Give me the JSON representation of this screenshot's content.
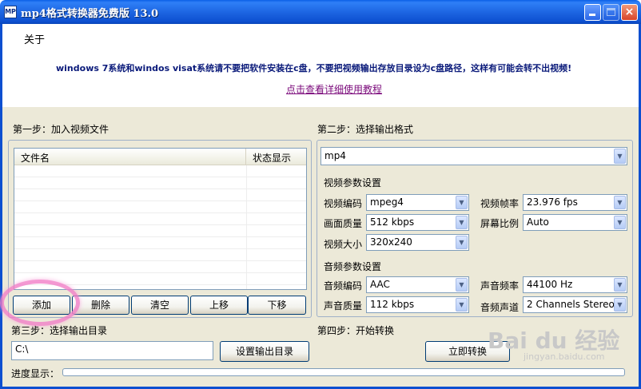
{
  "window": {
    "title": "mp4格式转换器免费版 13.0",
    "icon_label": "MP",
    "controls": {
      "minimize": "minimize-icon",
      "maximize": "maximize-icon",
      "close": "×"
    }
  },
  "header": {
    "about_label": "关于",
    "warning_text": "windows 7系统和windos visat系统请不要把软件安装在c盘，不要把视频输出存放目录设为c盘路径，这样有可能会转不出视频!",
    "tutorial_link": "点击查看详细使用教程"
  },
  "step1": {
    "label": "第一步：加入视频文件",
    "columns": [
      "文件名",
      "状态显示"
    ],
    "rows": []
  },
  "buttons": {
    "add": "添加",
    "delete": "删除",
    "clear": "清空",
    "move_up": "上移",
    "move_down": "下移",
    "set_output": "设置输出目录",
    "start": "立即转换"
  },
  "step2": {
    "label": "第二步：选择输出格式",
    "format": "mp4",
    "video_section": "视频参数设置",
    "video": {
      "codec_label": "视频编码",
      "codec": "mpeg4",
      "quality_label": "画面质量",
      "quality": "512 kbps",
      "size_label": "视频大小",
      "size": "320x240",
      "fps_label": "视频帧率",
      "fps": "23.976 fps",
      "aspect_label": "屏幕比例",
      "aspect": "Auto"
    },
    "audio_section": "音频参数设置",
    "audio": {
      "codec_label": "音频编码",
      "codec": "AAC",
      "quality_label": "声音质量",
      "quality": "112 kbps",
      "samplerate_label": "声音频率",
      "samplerate": "44100 Hz",
      "channels_label": "音频声道",
      "channels": "2 Channels Stereo"
    }
  },
  "step3": {
    "label": "第三步：选择输出目录",
    "path": "C:\\"
  },
  "step4": {
    "label": "第四步：开始转换"
  },
  "progress": {
    "label": "进度显示：",
    "value": 0
  },
  "watermark": {
    "text": "Bai du 经验",
    "url": "jingyan.baidu.com"
  },
  "colors": {
    "titlebar": "#0d4fd0",
    "link": "#7b0a7b",
    "warning": "#0a1a7a",
    "highlight": "#f27fc8",
    "progress_fill": "#2bc528"
  }
}
